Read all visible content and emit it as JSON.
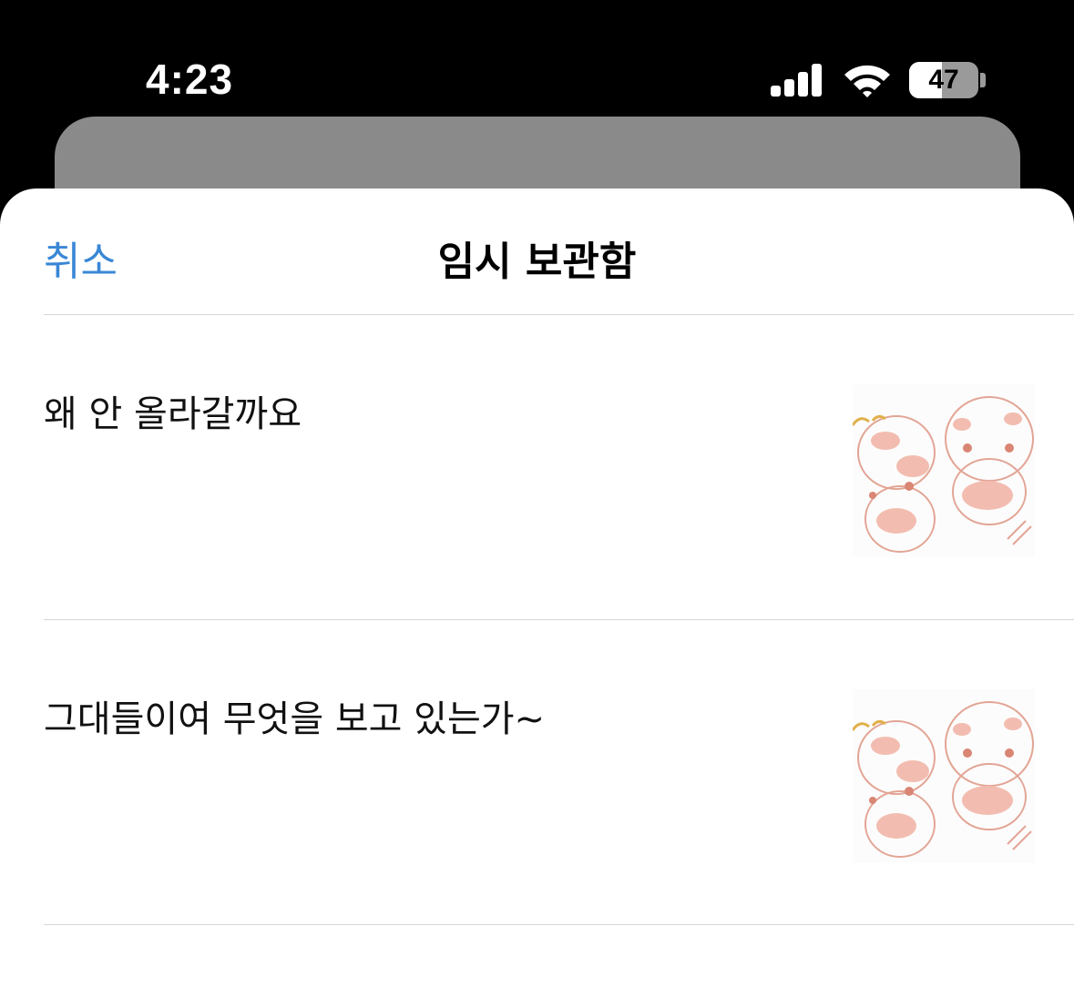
{
  "status_bar": {
    "time": "4:23",
    "battery_percent": "47",
    "battery_level": 0.47,
    "signal_bars": 4
  },
  "sheet": {
    "cancel_label": "취소",
    "title": "임시 보관함"
  },
  "drafts": [
    {
      "text": "왜 안 올라갈까요",
      "thumbnail": "cartoon-characters-image"
    },
    {
      "text": "그대들이여 무엇을 보고 있는가~",
      "thumbnail": "cartoon-characters-image"
    }
  ],
  "colors": {
    "accent": "#3a87d6",
    "background": "#000000",
    "sheet": "#ffffff",
    "illustration": "#e8a090"
  }
}
